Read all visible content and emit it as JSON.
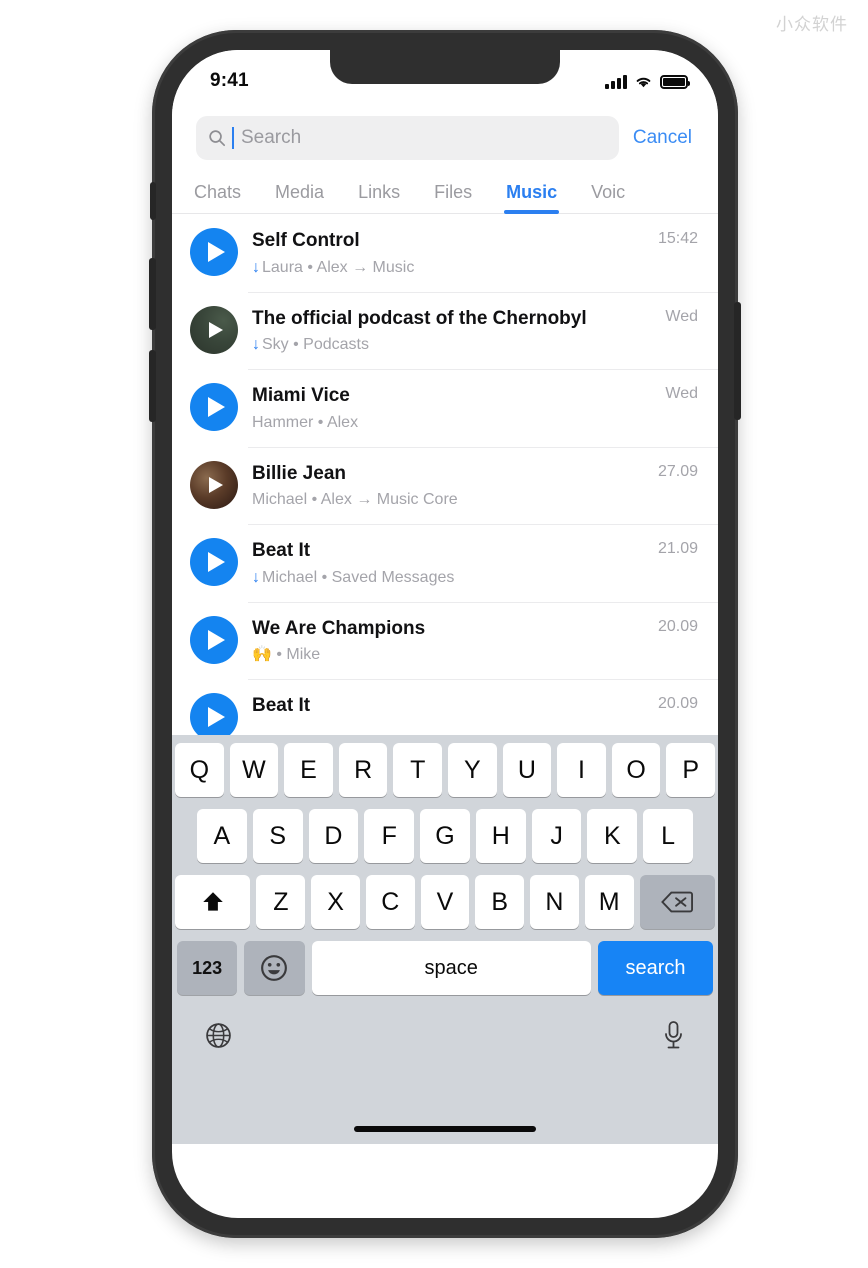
{
  "watermark": "小众软件",
  "status_bar": {
    "time": "9:41",
    "signal_icon": "cellular-signal-icon",
    "wifi_icon": "wifi-icon",
    "battery_icon": "battery-full-icon"
  },
  "search": {
    "placeholder": "Search",
    "value": "",
    "cancel_label": "Cancel",
    "icon": "search-icon"
  },
  "tabs": [
    {
      "label": "Chats",
      "active": false
    },
    {
      "label": "Media",
      "active": false
    },
    {
      "label": "Links",
      "active": false
    },
    {
      "label": "Files",
      "active": false
    },
    {
      "label": "Music",
      "active": true
    },
    {
      "label": "Voic",
      "active": false
    }
  ],
  "list": [
    {
      "title": "Self Control",
      "downloaded": true,
      "emoji": "",
      "subtitle": "Laura • Alex → Music",
      "time": "15:42",
      "thumb": "play-button-blue"
    },
    {
      "title": "The official podcast of the Chernobyl",
      "downloaded": true,
      "emoji": "",
      "subtitle": "Sky • Podcasts",
      "time": "Wed",
      "thumb": "album-art-green"
    },
    {
      "title": "Miami Vice",
      "downloaded": false,
      "emoji": "",
      "subtitle": "Hammer • Alex",
      "time": "Wed",
      "thumb": "play-button-blue"
    },
    {
      "title": "Billie Jean",
      "downloaded": false,
      "emoji": "",
      "subtitle": "Michael • Alex → Music Core",
      "time": "27.09",
      "thumb": "album-art-brown"
    },
    {
      "title": "Beat It",
      "downloaded": true,
      "emoji": "",
      "subtitle": "Michael • Saved Messages",
      "time": "21.09",
      "thumb": "play-button-blue"
    },
    {
      "title": "We Are Champions",
      "downloaded": false,
      "emoji": "🙌",
      "subtitle": "• Mike",
      "time": "20.09",
      "thumb": "play-button-blue"
    },
    {
      "title": "Beat It",
      "downloaded": false,
      "emoji": "",
      "subtitle": "",
      "time": "20.09",
      "thumb": "play-button-blue"
    }
  ],
  "keyboard": {
    "row1": [
      "Q",
      "W",
      "E",
      "R",
      "T",
      "Y",
      "U",
      "I",
      "O",
      "P"
    ],
    "row2": [
      "A",
      "S",
      "D",
      "F",
      "G",
      "H",
      "J",
      "K",
      "L"
    ],
    "row3": [
      "Z",
      "X",
      "C",
      "V",
      "B",
      "N",
      "M"
    ],
    "shift_icon": "shift-icon",
    "backspace_icon": "backspace-icon",
    "numbers_label": "123",
    "emoji_icon": "emoji-icon",
    "space_label": "space",
    "search_label": "search",
    "globe_icon": "globe-icon",
    "mic_icon": "microphone-icon"
  },
  "colors": {
    "accent_blue": "#1484f0",
    "link_blue": "#3b8cf4",
    "tab_active": "#2b7ff0",
    "muted_text": "#a4a4aa",
    "frame": "#2f2f2f",
    "keyboard_bg": "#d1d5da"
  }
}
